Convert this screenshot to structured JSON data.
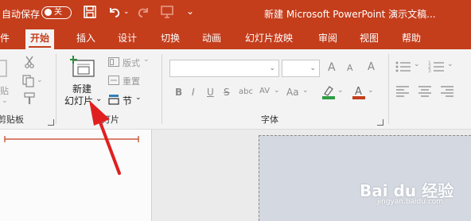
{
  "titlebar": {
    "autosave_label": "自动保存",
    "autosave_state": "关",
    "document_title": "新建 Microsoft PowerPoint 演示文稿...",
    "accent": "#c43e1c"
  },
  "tabs": [
    {
      "label": "件"
    },
    {
      "label": "开始"
    },
    {
      "label": "插入"
    },
    {
      "label": "设计"
    },
    {
      "label": "切换"
    },
    {
      "label": "动画"
    },
    {
      "label": "幻灯片放映"
    },
    {
      "label": "审阅"
    },
    {
      "label": "视图"
    },
    {
      "label": "帮助"
    }
  ],
  "ribbon": {
    "clipboard": {
      "paste_label": "贴",
      "group_label": "剪贴板"
    },
    "slides": {
      "new_slide_line1": "新建",
      "new_slide_line2": "幻灯片",
      "layout_label": "版式",
      "reset_label": "重置",
      "section_label": "节",
      "group_label": "幻灯片"
    },
    "font": {
      "font_name": "",
      "font_size": "",
      "bold": "B",
      "italic": "I",
      "underline": "U",
      "strikethrough": "S",
      "shadow": "abc",
      "spacing": "AV",
      "case": "Aa",
      "group_label": "字体"
    }
  },
  "watermark": {
    "brand": "Bai du 经验",
    "url": "jingyan.baidu.com"
  },
  "icons": [
    "save-icon",
    "undo-icon",
    "redo-icon",
    "start-from-beginning-icon",
    "customize-qat-icon",
    "cut-icon",
    "copy-icon",
    "format-painter-icon",
    "new-slide-icon",
    "layout-icon",
    "reset-icon",
    "section-icon",
    "bullets-icon",
    "numbering-icon",
    "align-left-icon",
    "align-center-icon",
    "font-color-icon",
    "highlight-icon"
  ]
}
